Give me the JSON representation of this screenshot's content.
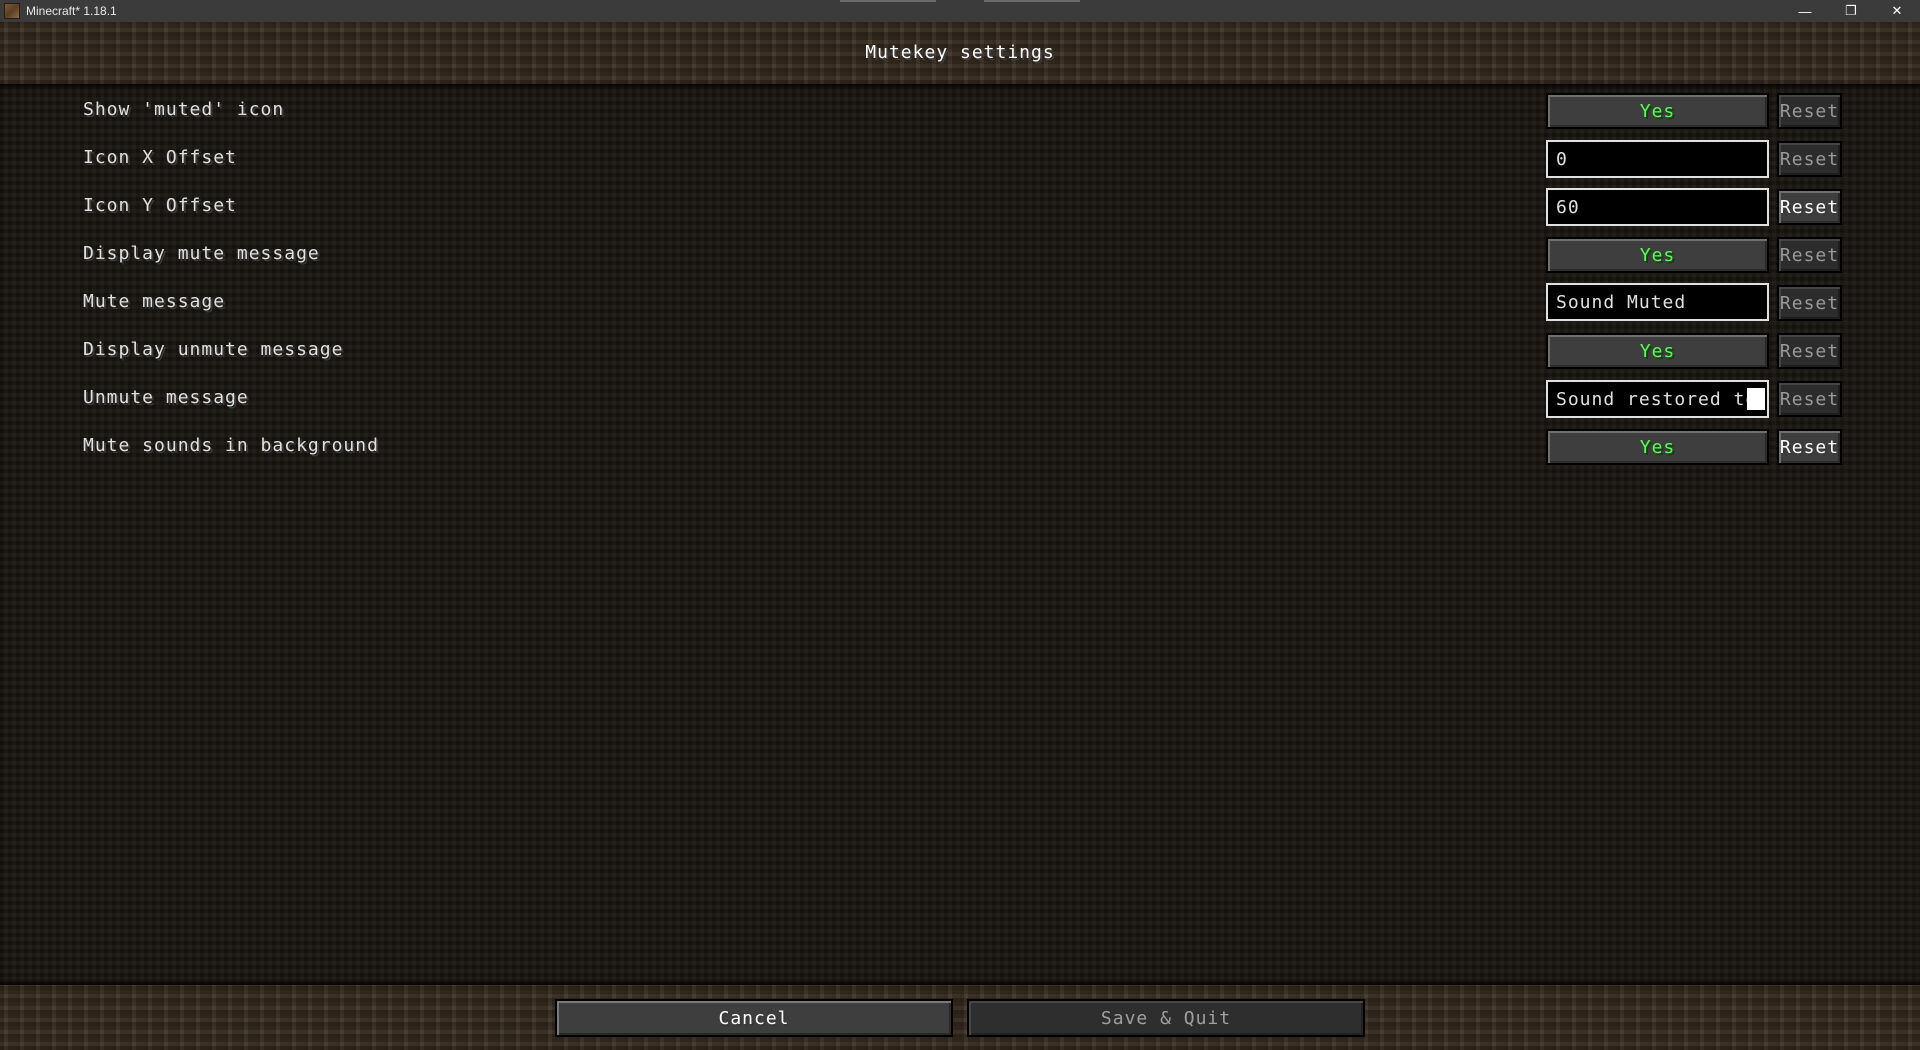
{
  "window": {
    "title": "Minecraft* 1.18.1",
    "minimize_glyph": "—",
    "restore_glyph": "❐",
    "close_glyph": "✕"
  },
  "screen": {
    "title": "Mutekey settings"
  },
  "settings": [
    {
      "label": "Show 'muted' icon",
      "control": "toggle",
      "value": "Yes",
      "reset_label": "Reset",
      "reset_enabled": false
    },
    {
      "label": "Icon X Offset",
      "control": "text",
      "value": "0",
      "reset_label": "Reset",
      "reset_enabled": false
    },
    {
      "label": "Icon Y Offset",
      "control": "text",
      "value": "60",
      "reset_label": "Reset",
      "reset_enabled": true
    },
    {
      "label": "Display mute message",
      "control": "toggle",
      "value": "Yes",
      "reset_label": "Reset",
      "reset_enabled": false
    },
    {
      "label": "Mute message",
      "control": "text",
      "value": "Sound Muted",
      "reset_label": "Reset",
      "reset_enabled": false
    },
    {
      "label": "Display unmute message",
      "control": "toggle",
      "value": "Yes",
      "reset_label": "Reset",
      "reset_enabled": false
    },
    {
      "label": "Unmute message",
      "control": "text",
      "value": "Sound restored to",
      "reset_label": "Reset",
      "reset_enabled": false
    },
    {
      "label": "Mute sounds in background",
      "control": "toggle",
      "value": "Yes",
      "reset_label": "Reset",
      "reset_enabled": true
    }
  ],
  "footer": {
    "cancel_label": "Cancel",
    "save_label": "Save & Quit"
  },
  "colors": {
    "toggle_yes": "#55ff55",
    "label_text": "#e0e0e0",
    "reset_disabled": "#9a9a9a"
  }
}
